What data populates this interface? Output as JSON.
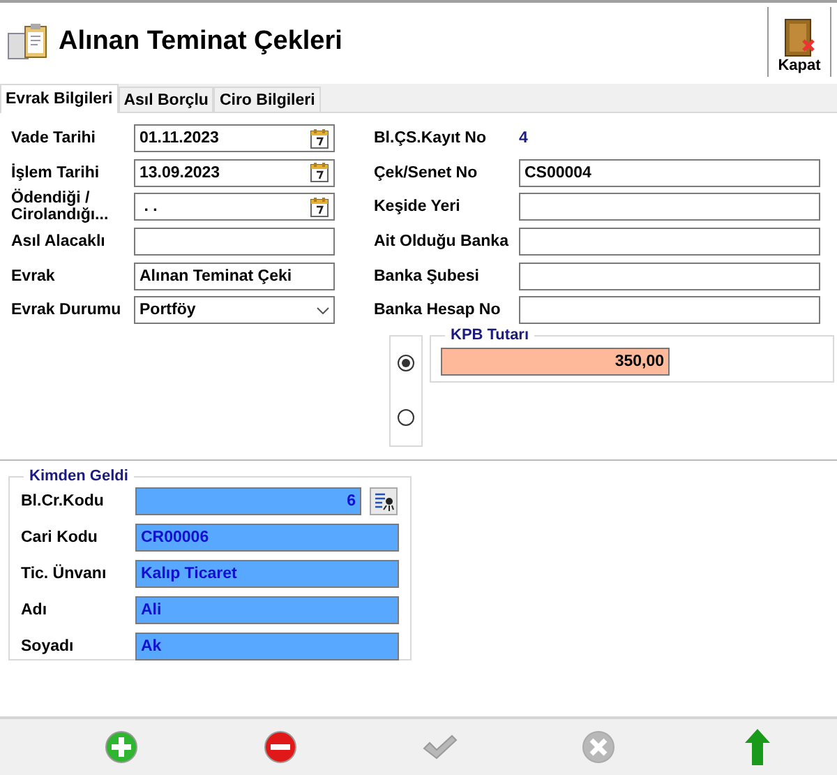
{
  "header": {
    "title": "Alınan Teminat Çekleri",
    "close_button": "Kapat"
  },
  "tabs": [
    {
      "label": "Evrak Bilgileri",
      "selected": true
    },
    {
      "label": "Asıl Borçlu",
      "selected": false
    },
    {
      "label": "Ciro Bilgileri",
      "selected": false
    }
  ],
  "left_fields": [
    {
      "label": "Vade Tarihi",
      "kind": "date",
      "value": "01.11.2023"
    },
    {
      "label": "İşlem Tarihi",
      "kind": "date",
      "value": "13.09.2023"
    },
    {
      "label": "Ödendiği / Cirolandığı...",
      "kind": "date",
      "value": " . ."
    },
    {
      "label": "Asıl Alacaklı",
      "kind": "text"
    },
    {
      "label": "Evrak",
      "kind": "text",
      "value": "Alınan Teminat Çeki"
    },
    {
      "label": "Evrak Durumu",
      "kind": "select",
      "value": "Portföy"
    }
  ],
  "right_fields": [
    {
      "label": "Bl.ÇS.Kayıt No",
      "kind": "readout",
      "value": "4"
    },
    {
      "label": "Çek/Senet No",
      "kind": "text",
      "value": "CS00004"
    },
    {
      "label": "Keşide Yeri",
      "kind": "text"
    },
    {
      "label": "Ait Olduğu Banka",
      "kind": "text"
    },
    {
      "label": "Banka Şubesi",
      "kind": "text"
    },
    {
      "label": "Banka Hesap No",
      "kind": "text"
    }
  ],
  "amount_options": [
    {
      "selected": true
    },
    {
      "selected": false
    }
  ],
  "kpb": {
    "title": "KPB Tutarı",
    "value": "350,00"
  },
  "kimden_geldi": {
    "title": "Kimden Geldi",
    "fields": [
      {
        "label": "Bl.Cr.Kodu",
        "kind": "lookup",
        "value": "6"
      },
      {
        "label": "Cari Kodu",
        "kind": "text",
        "value": "CR00006"
      },
      {
        "label": "Tic. Ünvanı",
        "kind": "text",
        "value": "Kalıp Ticaret"
      },
      {
        "label": "Adı",
        "kind": "text",
        "value": "Ali"
      },
      {
        "label": "Soyadı",
        "kind": "text",
        "value": "Ak"
      }
    ]
  },
  "toolbar": [
    {
      "kind": "add",
      "disabled": false
    },
    {
      "kind": "delete",
      "disabled": false
    },
    {
      "kind": "save",
      "disabled": true
    },
    {
      "kind": "cancel",
      "disabled": true
    },
    {
      "kind": "up",
      "disabled": false
    }
  ]
}
